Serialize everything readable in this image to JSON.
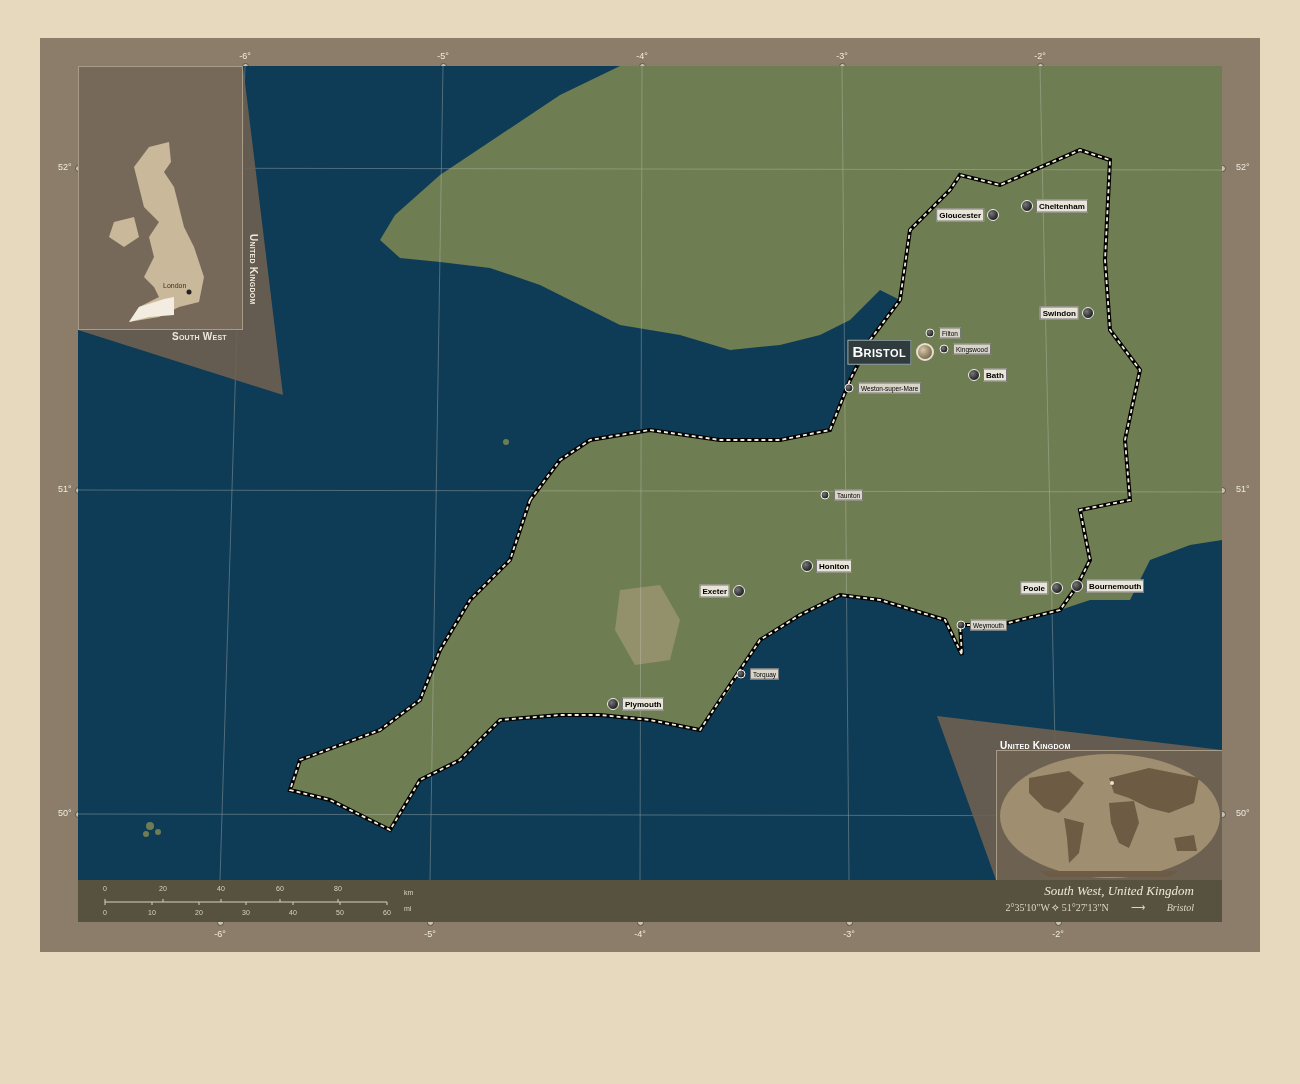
{
  "graticule": {
    "top_ticks": [
      "-6°",
      "-5°",
      "-4°",
      "-3°",
      "-2°"
    ],
    "bottom_ticks": [
      "-6°",
      "-5°",
      "-4°",
      "-3°",
      "-2°"
    ],
    "left_ticks": [
      "52°",
      "51°",
      "50°"
    ],
    "right_ticks": [
      "52°",
      "51°",
      "50°"
    ]
  },
  "places": [
    {
      "name": "Gloucester",
      "kind": "city"
    },
    {
      "name": "Cheltenham",
      "kind": "city"
    },
    {
      "name": "Swindon",
      "kind": "city"
    },
    {
      "name": "Filton",
      "kind": "town"
    },
    {
      "name": "Bristol",
      "kind": "capital"
    },
    {
      "name": "Kingswood",
      "kind": "town"
    },
    {
      "name": "Bath",
      "kind": "city"
    },
    {
      "name": "Weston-super-Mare",
      "kind": "town"
    },
    {
      "name": "Taunton",
      "kind": "town"
    },
    {
      "name": "Honiton",
      "kind": "city"
    },
    {
      "name": "Exeter",
      "kind": "city"
    },
    {
      "name": "Poole",
      "kind": "city"
    },
    {
      "name": "Bournemouth",
      "kind": "city"
    },
    {
      "name": "Weymouth",
      "kind": "town"
    },
    {
      "name": "Torquay",
      "kind": "town"
    },
    {
      "name": "Plymouth",
      "kind": "city"
    }
  ],
  "uk_inset": {
    "title": "United Kingdom",
    "region": "South West",
    "capital": "London"
  },
  "world_inset": {
    "title": "United Kingdom"
  },
  "scale_bar": {
    "km_ticks": [
      "0",
      "20",
      "40",
      "60",
      "80"
    ],
    "km_unit": "km",
    "mi_ticks": [
      "0",
      "10",
      "20",
      "30",
      "40",
      "50",
      "60"
    ],
    "mi_unit": "mi"
  },
  "caption": {
    "title": "South West, United Kingdom",
    "coordinates": "2°35'10\"W ⟡ 51°27'13\"N",
    "arrow": "⟶",
    "capital": "Bristol"
  }
}
